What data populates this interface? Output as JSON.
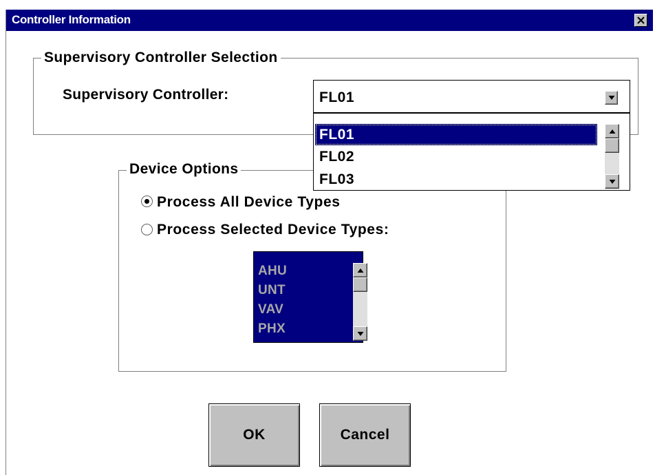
{
  "window": {
    "title": "Controller Information"
  },
  "supervisory_group": {
    "label": "Supervisory Controller Selection",
    "field_label": "Supervisory Controller:",
    "combo_value": "FL01",
    "options": [
      "FL01",
      "FL02",
      "FL03"
    ],
    "selected_option": "FL01"
  },
  "device_options": {
    "label": "Device Options",
    "radio_all": {
      "label": "Process All Device Types",
      "checked": true
    },
    "radio_selected": {
      "label": "Process Selected Device Types:",
      "checked": false
    },
    "device_types": [
      "AHU",
      "UNT",
      "VAV",
      "PHX"
    ],
    "list_enabled": false
  },
  "buttons": {
    "ok": "OK",
    "cancel": "Cancel"
  },
  "colors": {
    "title_bar": "#000080",
    "face": "#c0c0c0",
    "selection": "#000080",
    "disabled_text": "#a8a8a8"
  },
  "icons": {
    "close": "close-icon",
    "combo_arrow": "chevron-down-icon",
    "scroll_up": "scroll-up-icon",
    "scroll_down": "scroll-down-icon"
  }
}
